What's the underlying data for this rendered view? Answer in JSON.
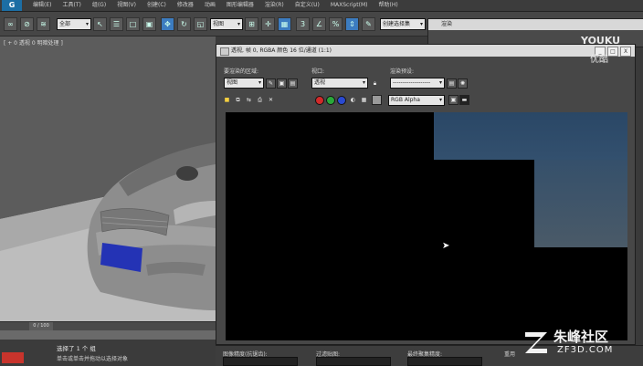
{
  "menubar": {
    "logo": "G",
    "items": [
      "编辑(E)",
      "工具(T)",
      "组(G)",
      "视图(V)",
      "创建(C)",
      "修改器",
      "动画",
      "图形编辑器",
      "渲染(R)",
      "自定义(U)",
      "MAXScript(M)",
      "帮助(H)"
    ]
  },
  "toolbar": {
    "selection_filter": "全部",
    "ref_coord": "视图",
    "named_selection": "创建选择集"
  },
  "viewport": {
    "label": "[ + 0 透视 0 明暗处理 ]"
  },
  "timeline": {
    "frame": "0 / 100"
  },
  "status": {
    "line1": "选择了 1 个 组",
    "line2": "单击或单击并拖动以选择对象"
  },
  "render_window": {
    "title": "透视, 帧 0, RGBA 颜色 16 位/通道 (1:1)",
    "area_label": "要渲染的区域:",
    "area_value": "视图",
    "viewport_label": "视口:",
    "viewport_value": "透视",
    "preset_label": "渲染预设:",
    "preset_value": "-------------------",
    "channel_value": "RGB Alpha",
    "buttons": {
      "minimize": "_",
      "maximize": "□",
      "close": "X"
    }
  },
  "side_panel": {
    "title": "渲染"
  },
  "bottom_bar": {
    "label1": "图像精度(抗锯齿):",
    "label2": "过滤贴图:",
    "label3": "最终聚集精度:",
    "label4": "重用"
  },
  "watermarks": {
    "youku": "YOUKU",
    "youku_cn": "优酷",
    "zf_cn": "朱峰社区",
    "zf_en": "ZF3D.COM"
  },
  "colors": {
    "render_bg": "#000000",
    "tile_blue": "#2f4a66",
    "accent_blue": "#1c6ea4",
    "plate_blue": "#2433b5"
  }
}
